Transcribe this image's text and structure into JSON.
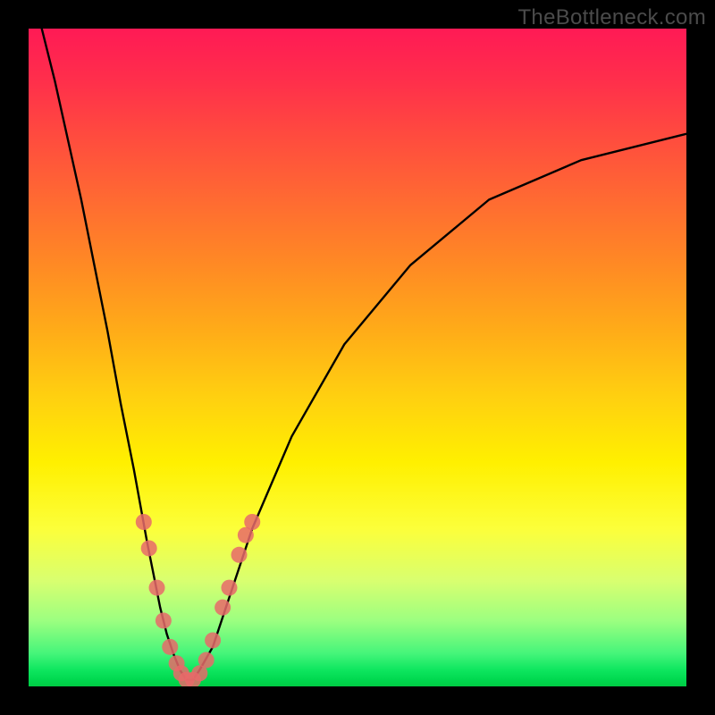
{
  "watermark": "TheBottleneck.com",
  "colors": {
    "frame": "#000000",
    "gradient_top": "#ff1a55",
    "gradient_mid": "#ffd010",
    "gradient_bottom": "#00cc44",
    "curve": "#000000",
    "marker": "#e86a6a"
  },
  "chart_data": {
    "type": "line",
    "title": "",
    "xlabel": "",
    "ylabel": "",
    "xlim": [
      0,
      100
    ],
    "ylim": [
      0,
      100
    ],
    "series": [
      {
        "name": "bottleneck-curve",
        "x": [
          2,
          4,
          6,
          8,
          10,
          12,
          14,
          16,
          18,
          20,
          21,
          22,
          23,
          24,
          25,
          26,
          28,
          30,
          34,
          40,
          48,
          58,
          70,
          84,
          100
        ],
        "y": [
          100,
          92,
          83,
          74,
          64,
          54,
          43,
          33,
          22,
          12,
          8,
          5,
          2.5,
          1,
          1,
          2.5,
          6,
          12,
          24,
          38,
          52,
          64,
          74,
          80,
          84
        ]
      }
    ],
    "markers": {
      "name": "highlight-dots",
      "color": "#e86a6a",
      "points": [
        {
          "x": 17.5,
          "y": 25
        },
        {
          "x": 18.3,
          "y": 21
        },
        {
          "x": 19.5,
          "y": 15
        },
        {
          "x": 20.5,
          "y": 10
        },
        {
          "x": 21.5,
          "y": 6
        },
        {
          "x": 22.5,
          "y": 3.5
        },
        {
          "x": 23.2,
          "y": 2
        },
        {
          "x": 24.0,
          "y": 1
        },
        {
          "x": 25.0,
          "y": 1
        },
        {
          "x": 26.0,
          "y": 2
        },
        {
          "x": 27.0,
          "y": 4
        },
        {
          "x": 28.0,
          "y": 7
        },
        {
          "x": 29.5,
          "y": 12
        },
        {
          "x": 30.5,
          "y": 15
        },
        {
          "x": 32.0,
          "y": 20
        },
        {
          "x": 33.0,
          "y": 23
        },
        {
          "x": 34.0,
          "y": 25
        }
      ]
    }
  }
}
